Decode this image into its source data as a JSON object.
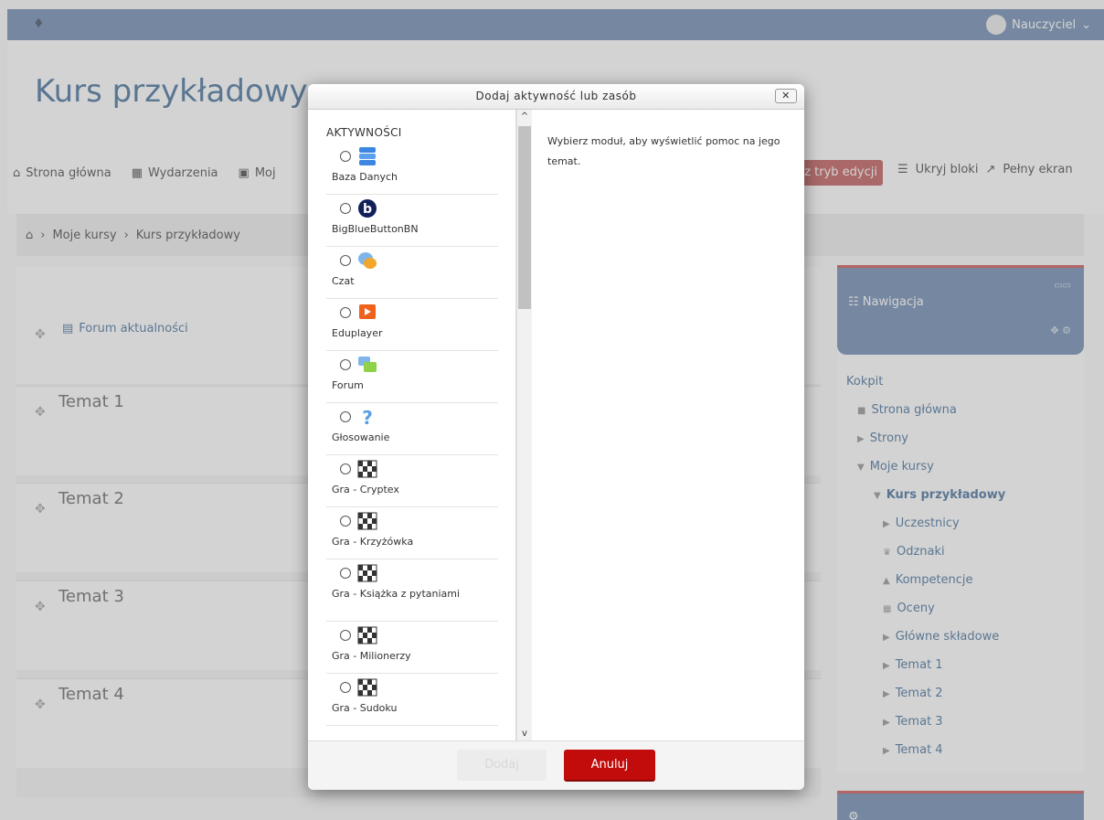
{
  "navbar": {
    "user_name": "Nauczyciel",
    "user_caret": "⌄"
  },
  "course": {
    "title": "Kurs przykładowy"
  },
  "toolbar": {
    "home": "Strona główna",
    "events": "Wydarzenia",
    "mycourses": "Moj",
    "edit_mode": "z tryb edycji",
    "hide_blocks": "Ukryj bloki",
    "fullscreen": "Pełny ekran"
  },
  "breadcrumb": {
    "items": [
      "Moje kursy",
      "Kurs przykładowy"
    ]
  },
  "course_main": {
    "forum_label": "Forum aktualności",
    "topics": [
      "Temat 1",
      "Temat 2",
      "Temat 3",
      "Temat 4"
    ]
  },
  "navigation_block": {
    "title": "Nawigacja",
    "items": [
      {
        "label": "Kokpit"
      },
      {
        "label": "Strona główna"
      },
      {
        "label": "Strony"
      },
      {
        "label": "Moje kursy"
      },
      {
        "label": "Kurs przykładowy"
      },
      {
        "label": "Uczestnicy"
      },
      {
        "label": "Odznaki"
      },
      {
        "label": "Kompetencje"
      },
      {
        "label": "Oceny"
      },
      {
        "label": "Główne składowe"
      },
      {
        "label": "Temat 1"
      },
      {
        "label": "Temat 2"
      },
      {
        "label": "Temat 3"
      },
      {
        "label": "Temat 4"
      }
    ]
  },
  "modal": {
    "title": "Dodaj aktywność lub zasób",
    "close_label": "✕",
    "category": "AKTYWNOŚCI",
    "activities": [
      {
        "label": "Baza Danych",
        "icon": "database-icon"
      },
      {
        "label": "BigBlueButtonBN",
        "icon": "bigbluebutton-icon"
      },
      {
        "label": "Czat",
        "icon": "chat-icon"
      },
      {
        "label": "Eduplayer",
        "icon": "eduplayer-icon"
      },
      {
        "label": "Forum",
        "icon": "forum-icon"
      },
      {
        "label": "Głosowanie",
        "icon": "question-icon"
      },
      {
        "label": "Gra - Cryptex",
        "icon": "game-icon"
      },
      {
        "label": "Gra - Krzyżówka",
        "icon": "game-icon"
      },
      {
        "label": "Gra - Książka z pytaniami",
        "icon": "game-icon"
      },
      {
        "label": "Gra - Milionerzy",
        "icon": "game-icon"
      },
      {
        "label": "Gra - Sudoku",
        "icon": "game-icon"
      }
    ],
    "help_text": "Wybierz moduł, aby wyświetlić pomoc na jego temat.",
    "add_button": "Dodaj",
    "cancel_button": "Anuluj"
  },
  "colors": {
    "navbar": "#5f7ea9",
    "accent_red": "#c20b0b",
    "link": "#2f5f8f"
  }
}
